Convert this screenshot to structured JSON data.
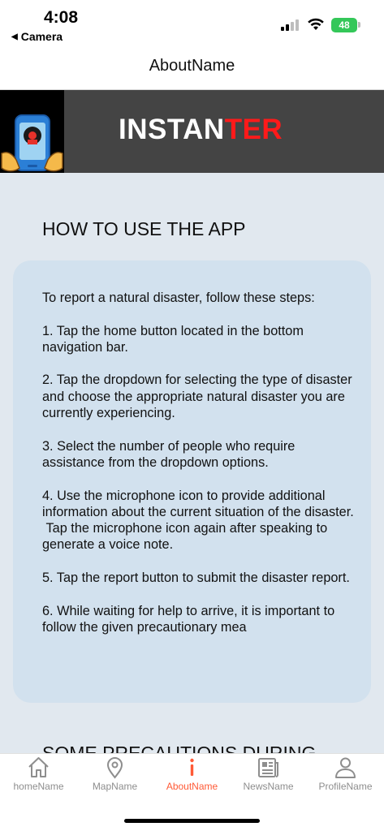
{
  "status_bar": {
    "time": "4:08",
    "back_app": "Camera",
    "battery": "48",
    "battery_color": "#34c759"
  },
  "header": {
    "title": "AboutName"
  },
  "banner": {
    "title_part1": "INSTAN",
    "title_part2": "TER",
    "background": "#444444",
    "accent": "#ff1a1a"
  },
  "main": {
    "section_title": "HOW TO USE THE APP",
    "instructions": "To report a natural disaster, follow these steps:\n\n1. Tap the home button located in the bottom navigation bar.\n\n2. Tap the dropdown for selecting the type of disaster and choose the appropriate natural disaster you are currently experiencing.\n\n3. Select the number of people who require assistance from the dropdown options.\n\n4. Use the microphone icon to provide additional information about the current situation of the disaster.\n Tap the microphone icon again after speaking to generate a voice note.\n\n5. Tap the report button to submit the disaster report.\n\n6. While waiting for help to arrive, it is important to follow the given precautionary mea",
    "next_section_title": "SOME PRECAUTIONS DURING"
  },
  "tab_bar": {
    "active_color": "#ff5a36",
    "tabs": [
      {
        "label": "homeName",
        "icon": "home-icon"
      },
      {
        "label": "MapName",
        "icon": "map-pin-icon"
      },
      {
        "label": "AboutName",
        "icon": "info-icon",
        "active": true
      },
      {
        "label": "NewsName",
        "icon": "newspaper-icon"
      },
      {
        "label": "ProfileName",
        "icon": "person-icon"
      }
    ]
  }
}
